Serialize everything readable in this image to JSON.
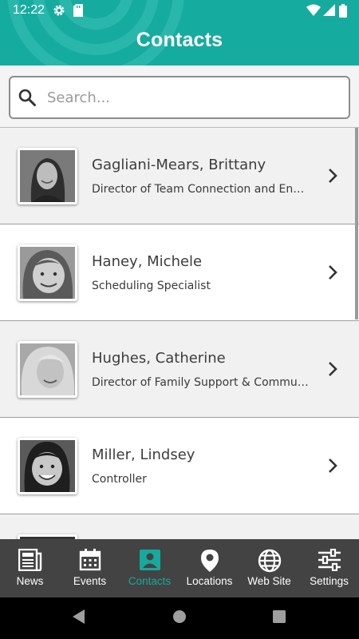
{
  "status_bar": {
    "time": "12:22",
    "icons": [
      "gear-icon",
      "sd-card-icon",
      "wifi-icon",
      "signal-icon",
      "battery-icon"
    ]
  },
  "header": {
    "title": "Contacts"
  },
  "search": {
    "placeholder": "Search...",
    "value": ""
  },
  "contacts": [
    {
      "name": "Gagliani-Mears, Brittany",
      "role": "Director of Team Connection and Engagement"
    },
    {
      "name": "Haney, Michele",
      "role": "Scheduling Specialist"
    },
    {
      "name": "Hughes, Catherine",
      "role": "Director of Family Support & Community Relations"
    },
    {
      "name": "Miller, Lindsey",
      "role": "Controller"
    },
    {
      "name": "",
      "role": ""
    }
  ],
  "tabs": [
    {
      "label": "News",
      "icon": "newspaper-icon"
    },
    {
      "label": "Events",
      "icon": "calendar-icon"
    },
    {
      "label": "Contacts",
      "icon": "contact-card-icon",
      "active": true
    },
    {
      "label": "Locations",
      "icon": "map-pin-icon"
    },
    {
      "label": "Web Site",
      "icon": "globe-icon"
    },
    {
      "label": "Settings",
      "icon": "sliders-icon"
    }
  ],
  "colors": {
    "header": "#16ab9f",
    "active_tab": "#17a99d",
    "bottom_nav": "#434343",
    "row_alt": "#f1f1f1"
  }
}
